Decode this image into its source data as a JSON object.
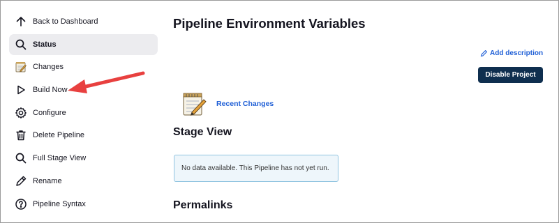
{
  "sidebar": {
    "items": [
      {
        "label": "Back to Dashboard",
        "icon": "arrow-up-icon",
        "active": false
      },
      {
        "label": "Status",
        "icon": "search-icon",
        "active": true
      },
      {
        "label": "Changes",
        "icon": "notepad-icon",
        "active": false
      },
      {
        "label": "Build Now",
        "icon": "play-icon",
        "active": false
      },
      {
        "label": "Configure",
        "icon": "gear-icon",
        "active": false
      },
      {
        "label": "Delete Pipeline",
        "icon": "trash-icon",
        "active": false
      },
      {
        "label": "Full Stage View",
        "icon": "search-icon",
        "active": false
      },
      {
        "label": "Rename",
        "icon": "pencil-icon",
        "active": false
      },
      {
        "label": "Pipeline Syntax",
        "icon": "help-circle-icon",
        "active": false
      }
    ]
  },
  "main": {
    "title": "Pipeline Environment Variables",
    "add_description": "Add description",
    "disable_button": "Disable Project",
    "recent_changes": "Recent Changes",
    "stage_view_title": "Stage View",
    "no_data_message": "No data available. This Pipeline has not yet run.",
    "permalinks_title": "Permalinks"
  },
  "colors": {
    "link": "#1f5fd6",
    "button_bg": "#0f2f4f",
    "active_bg": "#ececef",
    "info_bg": "#eef6fb",
    "info_border": "#8fc3e0",
    "annotation_arrow": "#e8403f"
  }
}
